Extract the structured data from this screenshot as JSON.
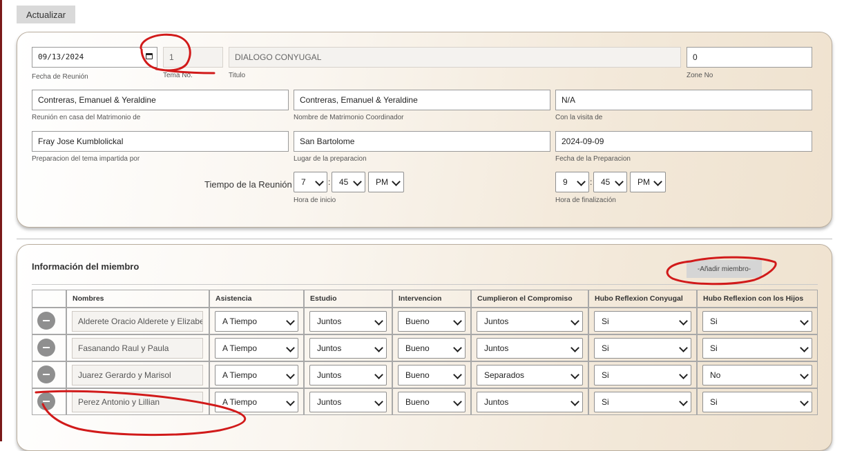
{
  "toolbar": {
    "update_label": "Actualizar"
  },
  "meeting": {
    "date_value": "09/13/2024",
    "date_label": "Fecha de Reunión",
    "tema_value": "1",
    "tema_label": "Tema No.",
    "title_value": "DIALOGO CONYUGAL",
    "title_label": "Titulo",
    "zone_value": "0",
    "zone_label": "Zone No",
    "host_value": "Contreras, Emanuel & Yeraldine",
    "host_label": "Reunión en casa del Matrimonio de",
    "coordinator_value": "Contreras, Emanuel & Yeraldine",
    "coordinator_label": "Nombre de Matrimonio Coordinador",
    "visit_value": "N/A",
    "visit_label": "Con la visita de",
    "prep_by_value": "Fray Jose Kumblolickal",
    "prep_by_label": "Preparacion del tema impartida por",
    "prep_place_value": "San Bartolome",
    "prep_place_label": "Lugar de la preparacion",
    "prep_date_value": "2024-09-09",
    "prep_date_label": "Fecha de la Preparacion",
    "time_label": "Tiempo de la Reunión",
    "start": {
      "hour": "7",
      "minute": "45",
      "ampm": "PM",
      "label": "Hora de inicio"
    },
    "end": {
      "hour": "9",
      "minute": "45",
      "ampm": "PM",
      "label": "Hora de finalización"
    },
    "colon": ":"
  },
  "members": {
    "title": "Información del miembro",
    "add_label": "-Añadir miembro-",
    "columns": [
      "",
      "Nombres",
      "Asistencia",
      "Estudio",
      "Intervencion",
      "Cumplieron el Compromiso",
      "Hubo Reflexion Conyugal",
      "Hubo Reflexion con los Hijos"
    ],
    "rows": [
      {
        "name": "Alderete Oracio Alderete y Elizabeth",
        "asistencia": "A Tiempo",
        "estudio": "Juntos",
        "intervencion": "Bueno",
        "compromiso": "Juntos",
        "conyugal": "Si",
        "hijos": "Si"
      },
      {
        "name": "Fasanando Raul  y Paula",
        "asistencia": "A Tiempo",
        "estudio": "Juntos",
        "intervencion": "Bueno",
        "compromiso": "Juntos",
        "conyugal": "Si",
        "hijos": "Si"
      },
      {
        "name": "Juarez Gerardo y Marisol",
        "asistencia": "A Tiempo",
        "estudio": "Juntos",
        "intervencion": "Bueno",
        "compromiso": "Separados",
        "conyugal": "Si",
        "hijos": "No"
      },
      {
        "name": "Perez Antonio y Lillian",
        "asistencia": "A Tiempo",
        "estudio": "Juntos",
        "intervencion": "Bueno",
        "compromiso": "Juntos",
        "conyugal": "Si",
        "hijos": "Si"
      }
    ]
  },
  "icons": {
    "calendar": "calendar-icon",
    "chevron": "chevron-down-icon",
    "remove": "minus-icon"
  },
  "colors": {
    "accent_border": "#7a1a1a",
    "annotation": "#d11a1a",
    "remove_button": "#8f8f8f"
  }
}
